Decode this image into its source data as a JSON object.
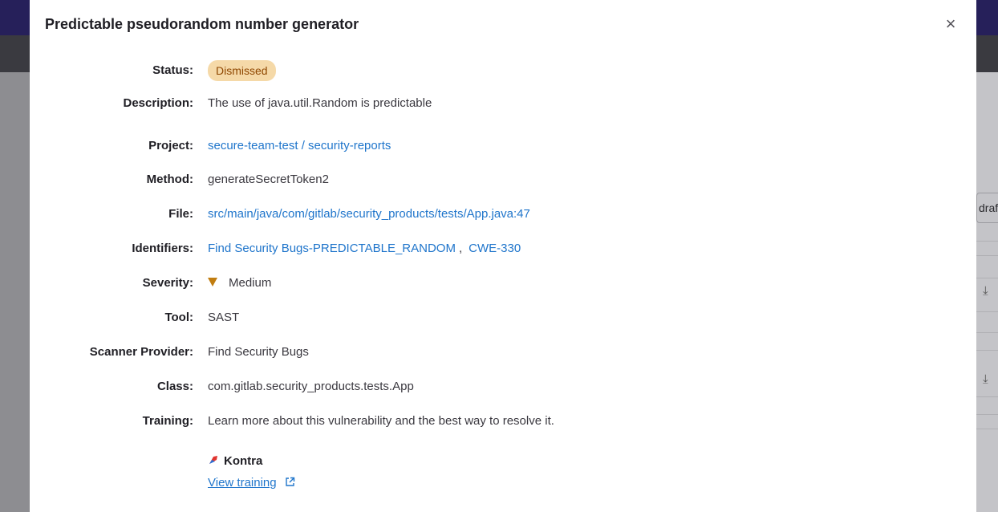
{
  "modal": {
    "title": "Predictable pseudorandom number generator",
    "close_icon": "×"
  },
  "details": {
    "status": {
      "label": "Status:",
      "value": "Dismissed"
    },
    "description": {
      "label": "Description:",
      "value": "The use of java.util.Random is predictable"
    },
    "project": {
      "label": "Project:",
      "value": "secure-team-test / security-reports"
    },
    "method": {
      "label": "Method:",
      "value": "generateSecretToken2"
    },
    "file": {
      "label": "File:",
      "value": "src/main/java/com/gitlab/security_products/tests/App.java:47"
    },
    "identifiers": {
      "label": "Identifiers:",
      "items": [
        "Find Security Bugs-PREDICTABLE_RANDOM",
        "CWE-330"
      ],
      "separator": ","
    },
    "severity": {
      "label": "Severity:",
      "value": "Medium",
      "icon": "severity-medium-icon",
      "color": "#c17d10"
    },
    "tool": {
      "label": "Tool:",
      "value": "SAST"
    },
    "scanner_provider": {
      "label": "Scanner Provider:",
      "value": "Find Security Bugs"
    },
    "class": {
      "label": "Class:",
      "value": "com.gitlab.security_products.tests.App"
    },
    "training": {
      "label": "Training:",
      "value": "Learn more about this vulnerability and the best way to resolve it."
    }
  },
  "training_provider": {
    "name": "Kontra",
    "icon": "kontra-logo-icon",
    "link_label": "View training",
    "link_icon": "external-link-icon"
  },
  "background": {
    "right_fragment": "draf"
  },
  "colors": {
    "link": "#1f75cb",
    "badge_bg": "#f5d9a8",
    "badge_text": "#8f4700",
    "severity_medium": "#c17d10"
  }
}
